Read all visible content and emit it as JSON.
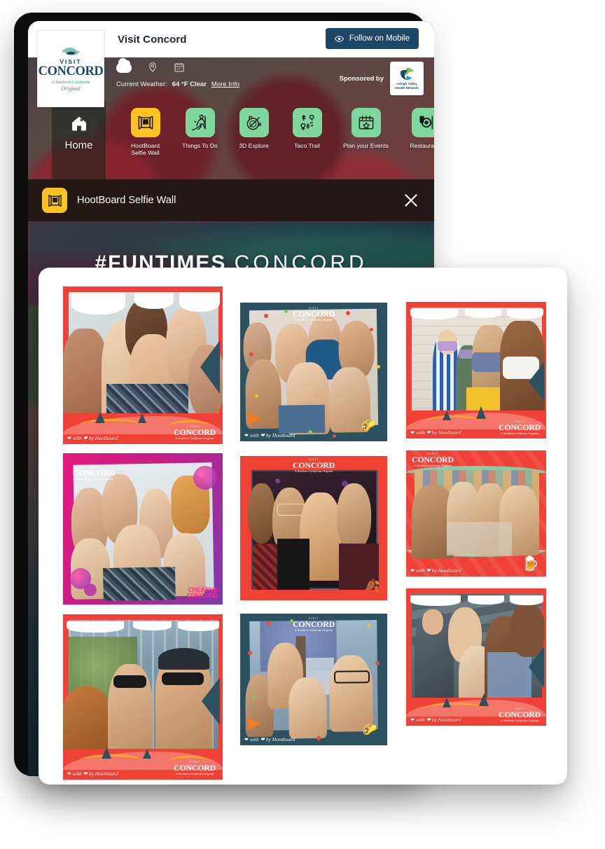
{
  "device": {
    "kind": "kiosk-tablet"
  },
  "topbar": {
    "title": "Visit Concord",
    "follow_button": "Follow on Mobile",
    "follow_icon": "eye-icon",
    "logo": {
      "visit": "VISIT",
      "name": "CONCORD",
      "tagline_1": "A Northern California",
      "tagline_2": "Original"
    }
  },
  "weather": {
    "label": "Current Weather:",
    "value": "64 °F Clear",
    "more_info": "More Info",
    "icons": [
      "cloud-icon",
      "map-pin-icon",
      "calendar-icon"
    ],
    "sponsor_label": "Sponsored by",
    "sponsor_name": "Lehigh Valley Health Network"
  },
  "nav": {
    "items": [
      {
        "label": "Home",
        "icon": "home-icon",
        "active": true,
        "accent": false
      },
      {
        "label": "HootBoard\nSelfie Wall",
        "icon": "selfie-wall-icon",
        "active": false,
        "accent": true
      },
      {
        "label": "Things To Do",
        "icon": "hiker-icon",
        "active": false,
        "accent": false
      },
      {
        "label": "3D Explore",
        "icon": "compass-icon",
        "active": false,
        "accent": false
      },
      {
        "label": "Taco Trail",
        "icon": "trail-map-icon",
        "active": false,
        "accent": false
      },
      {
        "label": "Plan your Events",
        "icon": "calendar-star-icon",
        "active": false,
        "accent": false
      },
      {
        "label": "Restaurants",
        "icon": "dining-icon",
        "active": false,
        "accent": false
      }
    ]
  },
  "selfie_wall": {
    "header_title": "HootBoard Selfie Wall",
    "header_icon": "selfie-wall-icon",
    "close_icon": "close-icon",
    "banner_hash": "#FUNTIMES",
    "banner_place": "CONCORD",
    "watermark": "with ❤ by Hootboard",
    "brand_overlay": {
      "visit": "VISIT",
      "name": "CONCORD",
      "sub": "A Northern California Original"
    },
    "creative_badge": {
      "line1": "CREATIVE",
      "line2": "CONCORD"
    },
    "photos": [
      {
        "id": "p1",
        "column": 1,
        "frame": "red-trees",
        "caption": "Group of six friends smiling indoors",
        "watermark": true,
        "logo": true,
        "sticker": ""
      },
      {
        "id": "p2",
        "column": 1,
        "frame": "magenta-creative",
        "caption": "Six friends giving thumbs up",
        "watermark": false,
        "logo": true,
        "sticker": ""
      },
      {
        "id": "p3",
        "column": 1,
        "frame": "red-trees",
        "caption": "Couple with dog wearing sunglasses",
        "watermark": true,
        "logo": true,
        "sticker": ""
      },
      {
        "id": "p4",
        "column": 2,
        "frame": "teal-confetti",
        "caption": "Six friends on a couch selfie",
        "watermark": true,
        "logo": true,
        "sticker": "taco"
      },
      {
        "id": "p5",
        "column": 2,
        "frame": "red-border",
        "caption": "Four men cheering at a bar",
        "watermark": false,
        "logo": true,
        "sticker": "leaf"
      },
      {
        "id": "p6",
        "column": 2,
        "frame": "teal-confetti",
        "caption": "Three women laughing outdoors",
        "watermark": true,
        "logo": true,
        "sticker": "taco"
      },
      {
        "id": "p7",
        "column": 3,
        "frame": "red-trees",
        "caption": "Four friends wearing face masks",
        "watermark": true,
        "logo": true,
        "sticker": ""
      },
      {
        "id": "p8",
        "column": 3,
        "frame": "red-mural",
        "caption": "Four friends hugging by a mural",
        "watermark": true,
        "logo": true,
        "sticker": "beer"
      },
      {
        "id": "p9",
        "column": 3,
        "frame": "red-trees",
        "caption": "Four women seated on steps",
        "watermark": true,
        "logo": true,
        "sticker": ""
      }
    ]
  },
  "colors": {
    "accent_yellow": "#ffc222",
    "tile_green": "#7ed79c",
    "brand_navy": "#1d4766",
    "frame_red": "#ef4136",
    "frame_teal": "#2c5160",
    "frame_magenta": "#e6197e",
    "creative_pink": "#ff2d8a"
  }
}
